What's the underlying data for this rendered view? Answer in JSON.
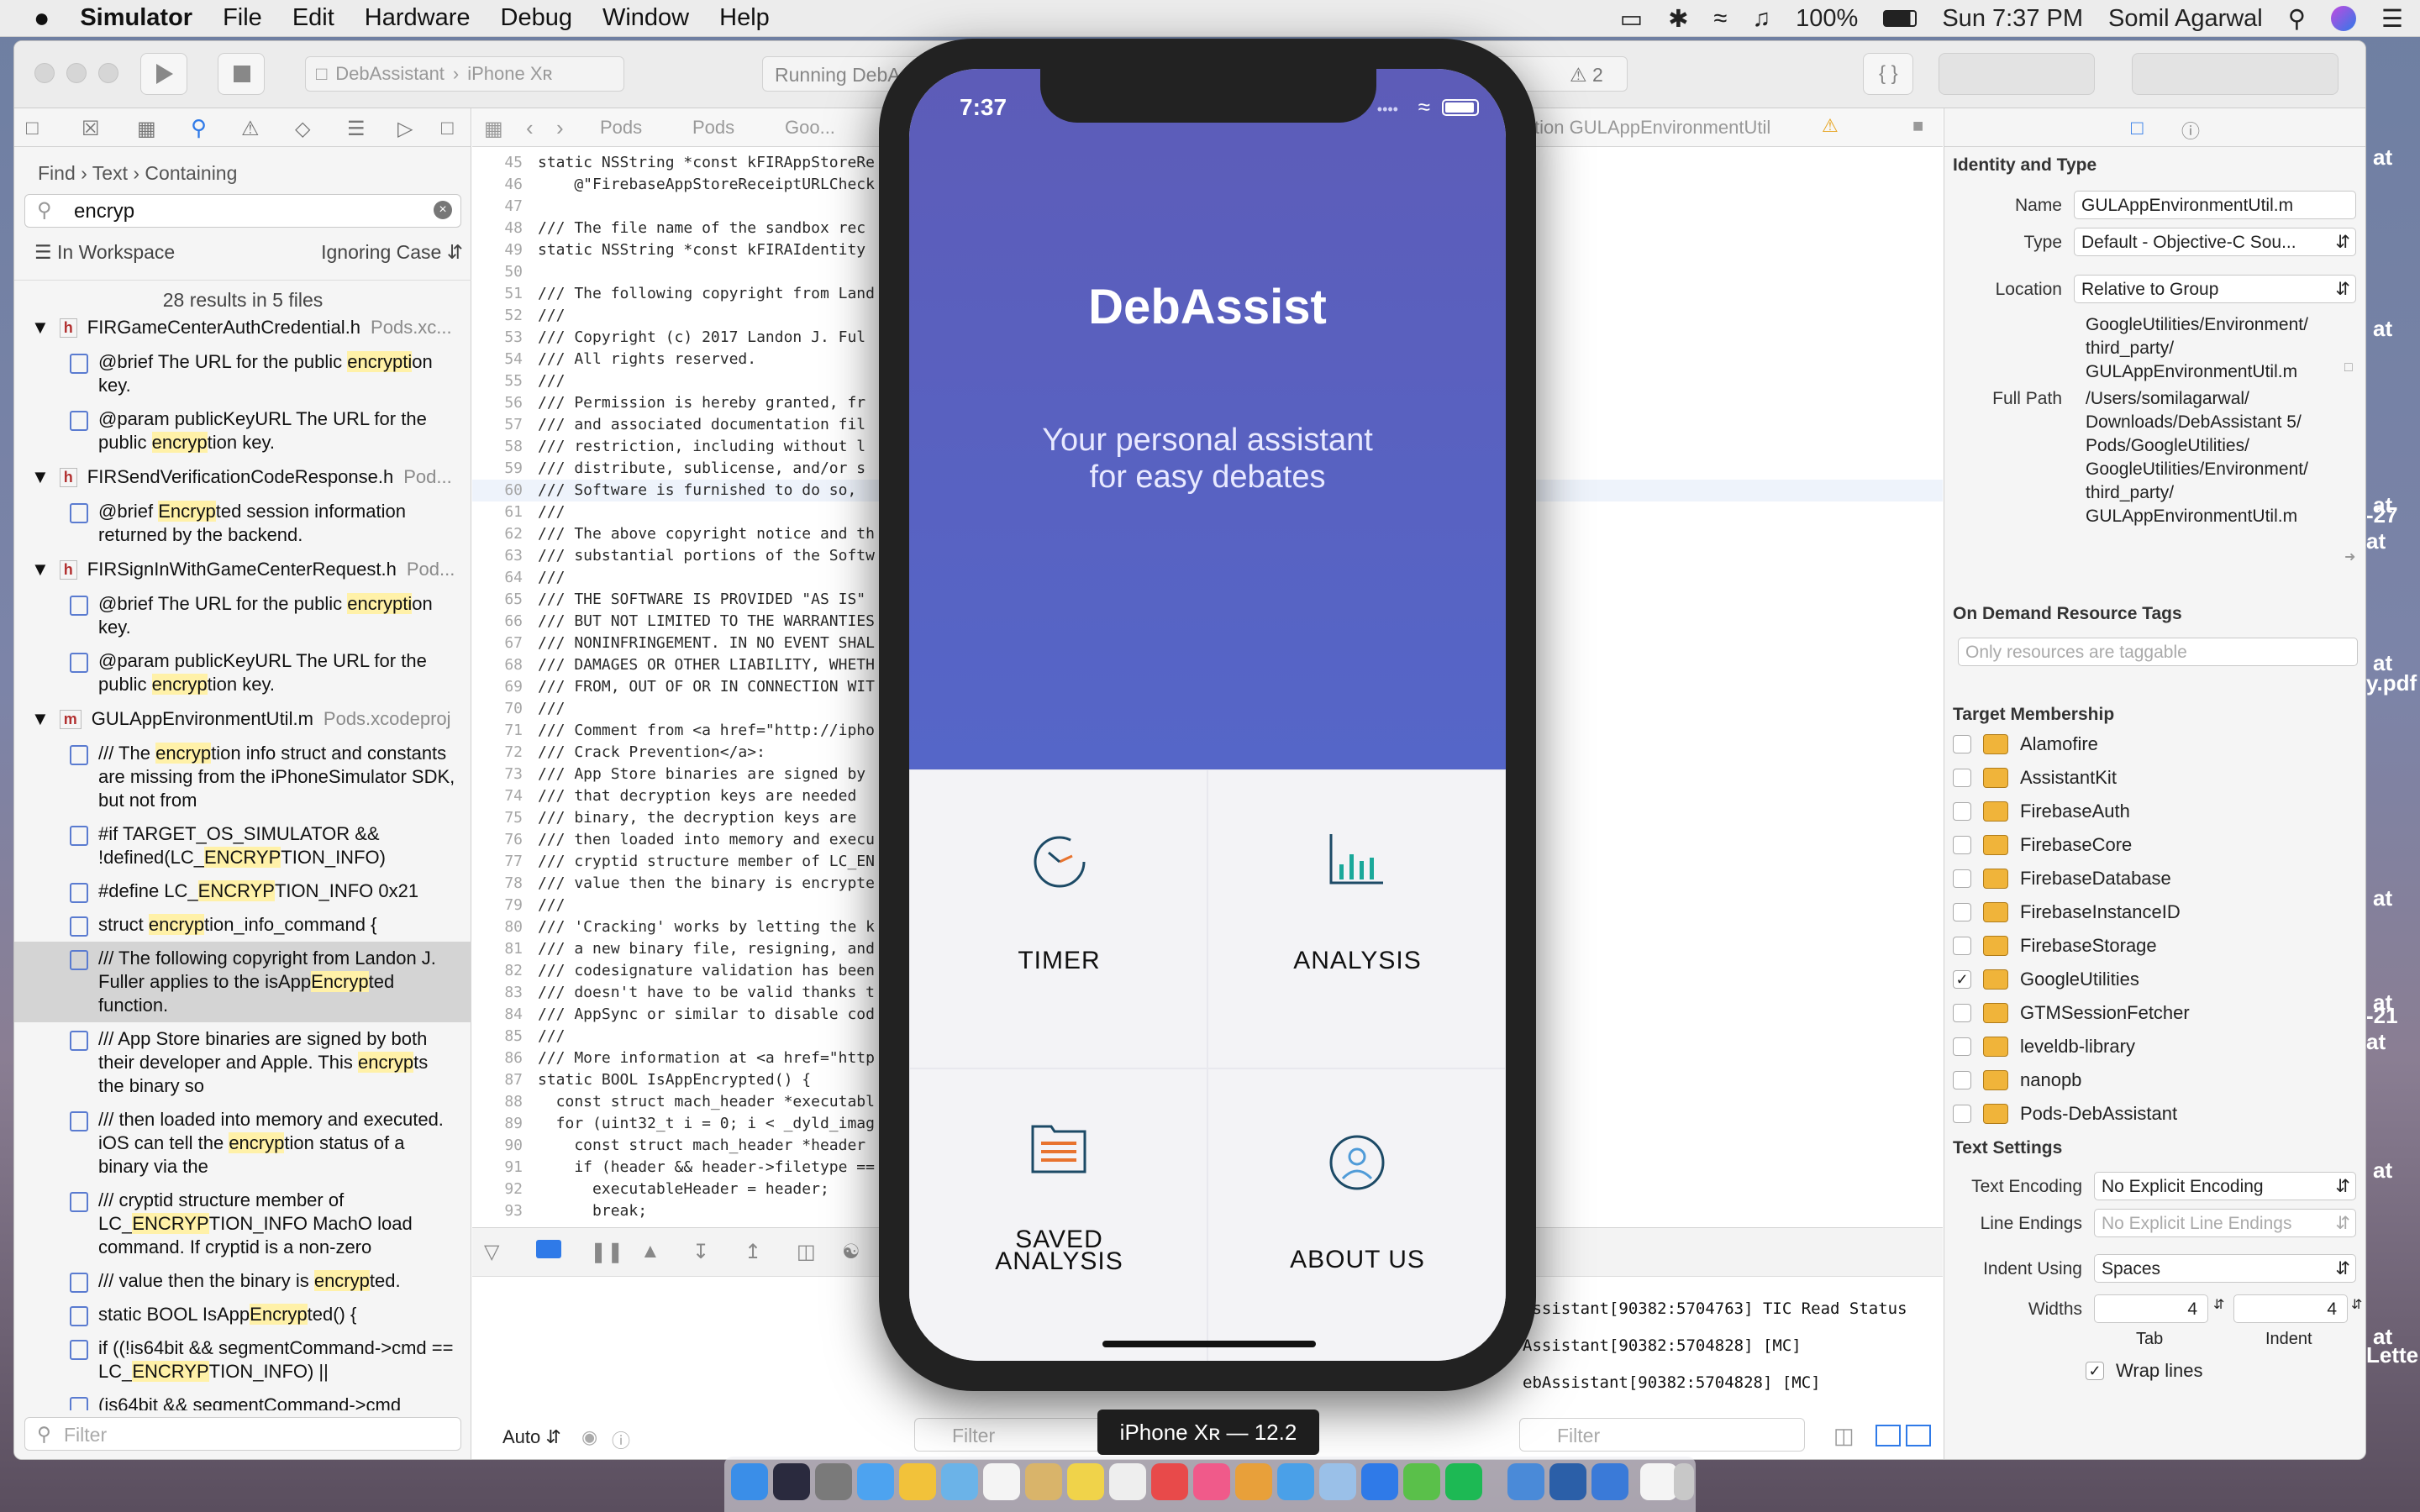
{
  "menubar": {
    "apple": "",
    "app": "Simulator",
    "items": [
      "File",
      "Edit",
      "Hardware",
      "Debug",
      "Window",
      "Help"
    ],
    "battery": "100%",
    "clock": "Sun 7:37 PM",
    "user": "Somil Agarwal"
  },
  "toolbar": {
    "scheme": "DebAssistant",
    "device": "iPhone Xʀ",
    "activity": "Running DebA",
    "warnings": "2"
  },
  "navigator": {
    "find": "Find",
    "text": "Text",
    "containing": "Containing",
    "query": "encryp",
    "scope": "In Workspace",
    "case": "Ignoring Case",
    "summary": "28 results in 5 files",
    "filter_placeholder": "Filter",
    "results": [
      {
        "file": "FIRGameCenterAuthCredential.h",
        "proj": "Pods.xc...",
        "type": "h",
        "matches": [
          [
            "@brief The URL for the public ",
            "encrypti",
            "on key."
          ],
          [
            "@param publicKeyURL The URL for the public ",
            "encryp",
            "tion key."
          ]
        ]
      },
      {
        "file": "FIRSendVerificationCodeResponse.h",
        "proj": "Pod...",
        "type": "h",
        "matches": [
          [
            "@brief ",
            "Encryp",
            "ted session information returned by the backend."
          ]
        ]
      },
      {
        "file": "FIRSignInWithGameCenterRequest.h",
        "proj": "Pod...",
        "type": "h",
        "matches": [
          [
            "@brief The URL for the public ",
            "encrypti",
            "on key."
          ],
          [
            "@param publicKeyURL The URL for the public ",
            "encryp",
            "tion key."
          ]
        ]
      },
      {
        "file": "GULAppEnvironmentUtil.m",
        "proj": "Pods.xcodeproj",
        "type": "m",
        "matches": [
          [
            "/// The ",
            "encryp",
            "tion info struct and constants are missing from the iPhoneSimulator SDK, but not from"
          ],
          [
            "#if TARGET_OS_SIMULATOR && !defined(LC_",
            "ENCRYP",
            "TION_INFO)"
          ],
          [
            "#define LC_",
            "ENCRYP",
            "TION_INFO 0x21"
          ],
          [
            "struct ",
            "encryp",
            "tion_info_command {"
          ],
          [
            "/// The following copyright from Landon J. Fuller applies to the isApp",
            "Encryp",
            "ted function."
          ],
          [
            "/// App Store binaries are signed by both their developer and Apple. This ",
            "encryp",
            "ts the binary so"
          ],
          [
            "/// then loaded into memory and executed. iOS can tell the ",
            "encryp",
            "tion status of a binary via the"
          ],
          [
            "/// cryptid structure member of LC_",
            "ENCRYP",
            "TION_INFO MachO load command. If cryptid is a non-zero"
          ],
          [
            "/// value then the binary is ",
            "encryp",
            "ted."
          ],
          [
            "static BOOL IsApp",
            "Encryp",
            "ted() {"
          ],
          [
            "if ((!is64bit && segmentCommand->cmd == LC_",
            "ENCRYP",
            "TION_INFO) ||"
          ],
          [
            "(is64bit && segmentCommand->cmd",
            "",
            ""
          ]
        ]
      }
    ]
  },
  "jumpbar": {
    "crumbs": [
      "Pods",
      "Pods",
      "Goo..."
    ],
    "right": "tion GULAppEnvironmentUtil"
  },
  "code": [
    [
      "45",
      "static NSString *const kFIRAppStoreRe"
    ],
    [
      "46",
      "    @\"FirebaseAppStoreReceiptURLCheck"
    ],
    [
      "47",
      ""
    ],
    [
      "48",
      "/// The file name of the sandbox rec"
    ],
    [
      "49",
      "static NSString *const kFIRAIdentity"
    ],
    [
      "50",
      ""
    ],
    [
      "51",
      "/// The following copyright from Land"
    ],
    [
      "52",
      "///"
    ],
    [
      "53",
      "/// Copyright (c) 2017 Landon J. Ful"
    ],
    [
      "54",
      "/// All rights reserved."
    ],
    [
      "55",
      "///"
    ],
    [
      "56",
      "/// Permission is hereby granted, fr"
    ],
    [
      "57",
      "/// and associated documentation fil"
    ],
    [
      "58",
      "/// restriction, including without l"
    ],
    [
      "59",
      "/// distribute, sublicense, and/or s"
    ],
    [
      "60",
      "/// Software is furnished to do so, "
    ],
    [
      "61",
      "///"
    ],
    [
      "62",
      "/// The above copyright notice and th"
    ],
    [
      "63",
      "/// substantial portions of the Softw"
    ],
    [
      "64",
      "///"
    ],
    [
      "65",
      "/// THE SOFTWARE IS PROVIDED \"AS IS\" "
    ],
    [
      "66",
      "/// BUT NOT LIMITED TO THE WARRANTIES"
    ],
    [
      "67",
      "/// NONINFRINGEMENT. IN NO EVENT SHAL"
    ],
    [
      "68",
      "/// DAMAGES OR OTHER LIABILITY, WHETH"
    ],
    [
      "69",
      "/// FROM, OUT OF OR IN CONNECTION WIT"
    ],
    [
      "70",
      "///"
    ],
    [
      "71",
      "/// Comment from <a href=\"http://ipho"
    ],
    [
      "72",
      "/// Crack Prevention</a>:"
    ],
    [
      "73",
      "/// App Store binaries are signed by "
    ],
    [
      "74",
      "/// that decryption keys are needed "
    ],
    [
      "75",
      "/// binary, the decryption keys are "
    ],
    [
      "76",
      "/// then loaded into memory and execu"
    ],
    [
      "77",
      "/// cryptid structure member of LC_EN"
    ],
    [
      "78",
      "/// value then the binary is encrypte"
    ],
    [
      "79",
      "///"
    ],
    [
      "80",
      "/// 'Cracking' works by letting the k"
    ],
    [
      "81",
      "/// a new binary file, resigning, and"
    ],
    [
      "82",
      "/// codesignature validation has been"
    ],
    [
      "83",
      "/// doesn't have to be valid thanks t"
    ],
    [
      "84",
      "/// AppSync or similar to disable cod"
    ],
    [
      "85",
      "///"
    ],
    [
      "86",
      "/// More information at <a href=\"http"
    ],
    [
      "87",
      "static BOOL IsAppEncrypted() {"
    ],
    [
      "88",
      "  const struct mach_header *executabl"
    ],
    [
      "89",
      "  for (uint32_t i = 0; i < _dyld_imag"
    ],
    [
      "90",
      "    const struct mach_header *header "
    ],
    [
      "91",
      "    if (header && header->filetype =="
    ],
    [
      "92",
      "      executableHeader = header;"
    ],
    [
      "93",
      "      break;"
    ]
  ],
  "debug": {
    "auto": "Auto",
    "filter": "Filter",
    "console": [
      "Assistant[90382:5704763] TIC Read Status",
      "Assistant[90382:5704828] [MC]",
      "ebAssistant[90382:5704828] [MC]"
    ]
  },
  "inspector": {
    "identity_title": "Identity and Type",
    "name_label": "Name",
    "name": "GULAppEnvironmentUtil.m",
    "type_label": "Type",
    "type": "Default - Objective-C Sou...",
    "location_label": "Location",
    "location": "Relative to Group",
    "location_path": [
      "GoogleUtilities/Environment/",
      "third_party/",
      "GULAppEnvironmentUtil.m"
    ],
    "fullpath_label": "Full Path",
    "fullpath": [
      "/Users/somilagarwal/",
      "Downloads/DebAssistant 5/",
      "Pods/GoogleUtilities/",
      "GoogleUtilities/Environment/",
      "third_party/",
      "GULAppEnvironmentUtil.m"
    ],
    "ondemand_title": "On Demand Resource Tags",
    "ondemand_placeholder": "Only resources are taggable",
    "target_title": "Target Membership",
    "targets": [
      {
        "name": "Alamofire",
        "checked": false
      },
      {
        "name": "AssistantKit",
        "checked": false
      },
      {
        "name": "FirebaseAuth",
        "checked": false
      },
      {
        "name": "FirebaseCore",
        "checked": false
      },
      {
        "name": "FirebaseDatabase",
        "checked": false
      },
      {
        "name": "FirebaseInstanceID",
        "checked": false
      },
      {
        "name": "FirebaseStorage",
        "checked": false
      },
      {
        "name": "GoogleUtilities",
        "checked": true
      },
      {
        "name": "GTMSessionFetcher",
        "checked": false
      },
      {
        "name": "leveldb-library",
        "checked": false
      },
      {
        "name": "nanopb",
        "checked": false
      },
      {
        "name": "Pods-DebAssistant",
        "checked": false
      }
    ],
    "text_title": "Text Settings",
    "encoding_label": "Text Encoding",
    "encoding": "No Explicit Encoding",
    "endings_label": "Line Endings",
    "endings": "No Explicit Line Endings",
    "indent_label": "Indent Using",
    "indent": "Spaces",
    "widths_label": "Widths",
    "tab_value": "4",
    "indent_value": "4",
    "tab_label": "Tab",
    "indentw_label": "Indent",
    "wrap_label": "Wrap lines",
    "wrap": true
  },
  "desktop_edge": [
    "at",
    "at",
    "at",
    "-27 at",
    "at",
    "y.pdf",
    "at",
    "at",
    "-21 at",
    "at",
    "at",
    "Lette"
  ],
  "phone": {
    "time": "7:37",
    "title": "DebAssist",
    "tagline_1": "Your personal assistant",
    "tagline_2": "for easy debates",
    "tiles": [
      "TIMER",
      "ANALYSIS",
      "SAVED",
      "ANALYSIS",
      "ABOUT US"
    ],
    "colors": {
      "hero": "#5a60bf",
      "accent": "#e8732e",
      "icon": "#1c4a66"
    }
  },
  "device_badge": "iPhone Xʀ — 12.2"
}
